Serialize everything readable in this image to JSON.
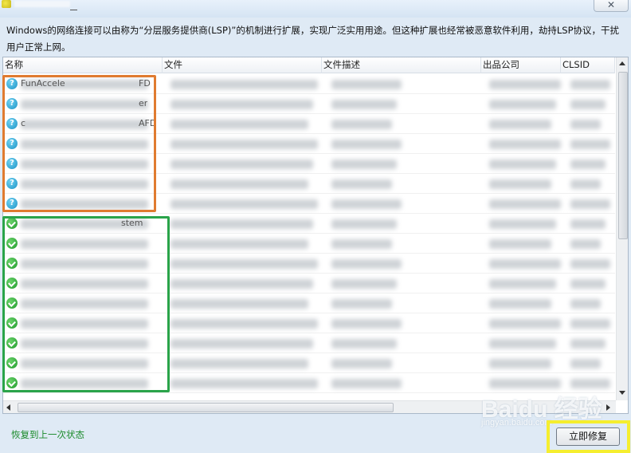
{
  "window": {
    "close_glyph": "✕"
  },
  "description": "Windows的网络连接可以由称为“分层服务提供商(LSP)”的机制进行扩展，实现广泛实用用途。但这种扩展也经常被恶意软件利用，劫持LSP协议，干扰用户正常上网。",
  "table": {
    "columns": [
      "名称",
      "文件",
      "文件描述",
      "出品公司",
      "CLSID"
    ],
    "rows": [
      {
        "status": "unknown",
        "name_fragment": "FunAccele",
        "name_tail": "FD"
      },
      {
        "status": "unknown",
        "name_fragment": "",
        "name_tail": "er"
      },
      {
        "status": "unknown",
        "name_fragment": "c",
        "name_tail": "AFD"
      },
      {
        "status": "unknown",
        "name_fragment": "",
        "name_tail": ""
      },
      {
        "status": "unknown",
        "name_fragment": "",
        "name_tail": ""
      },
      {
        "status": "unknown",
        "name_fragment": "",
        "name_tail": ""
      },
      {
        "status": "unknown",
        "name_fragment": "",
        "name_tail": ""
      },
      {
        "status": "ok",
        "name_fragment": "",
        "name_tail": "stem"
      },
      {
        "status": "ok",
        "name_fragment": "",
        "name_tail": ""
      },
      {
        "status": "ok",
        "name_fragment": "",
        "name_tail": ""
      },
      {
        "status": "ok",
        "name_fragment": "",
        "name_tail": ""
      },
      {
        "status": "ok",
        "name_fragment": "",
        "name_tail": ""
      },
      {
        "status": "ok",
        "name_fragment": "",
        "name_tail": ""
      },
      {
        "status": "ok",
        "name_fragment": "",
        "name_tail": ""
      },
      {
        "status": "ok",
        "name_fragment": "",
        "name_tail": ""
      },
      {
        "status": "ok",
        "name_fragment": "",
        "name_tail": ""
      }
    ]
  },
  "footer": {
    "restore_label": "恢复到上一次状态",
    "repair_label": "立即修复"
  },
  "watermark": {
    "brand": "Baidu 经验",
    "sub": "jingyan.baidu.com"
  },
  "colors": {
    "annotation_orange": "#e07b30",
    "annotation_green": "#2aa44a",
    "annotation_yellow": "#f5ee2f",
    "status_unknown": "#1d93c6",
    "status_ok": "#1f9a2a"
  }
}
